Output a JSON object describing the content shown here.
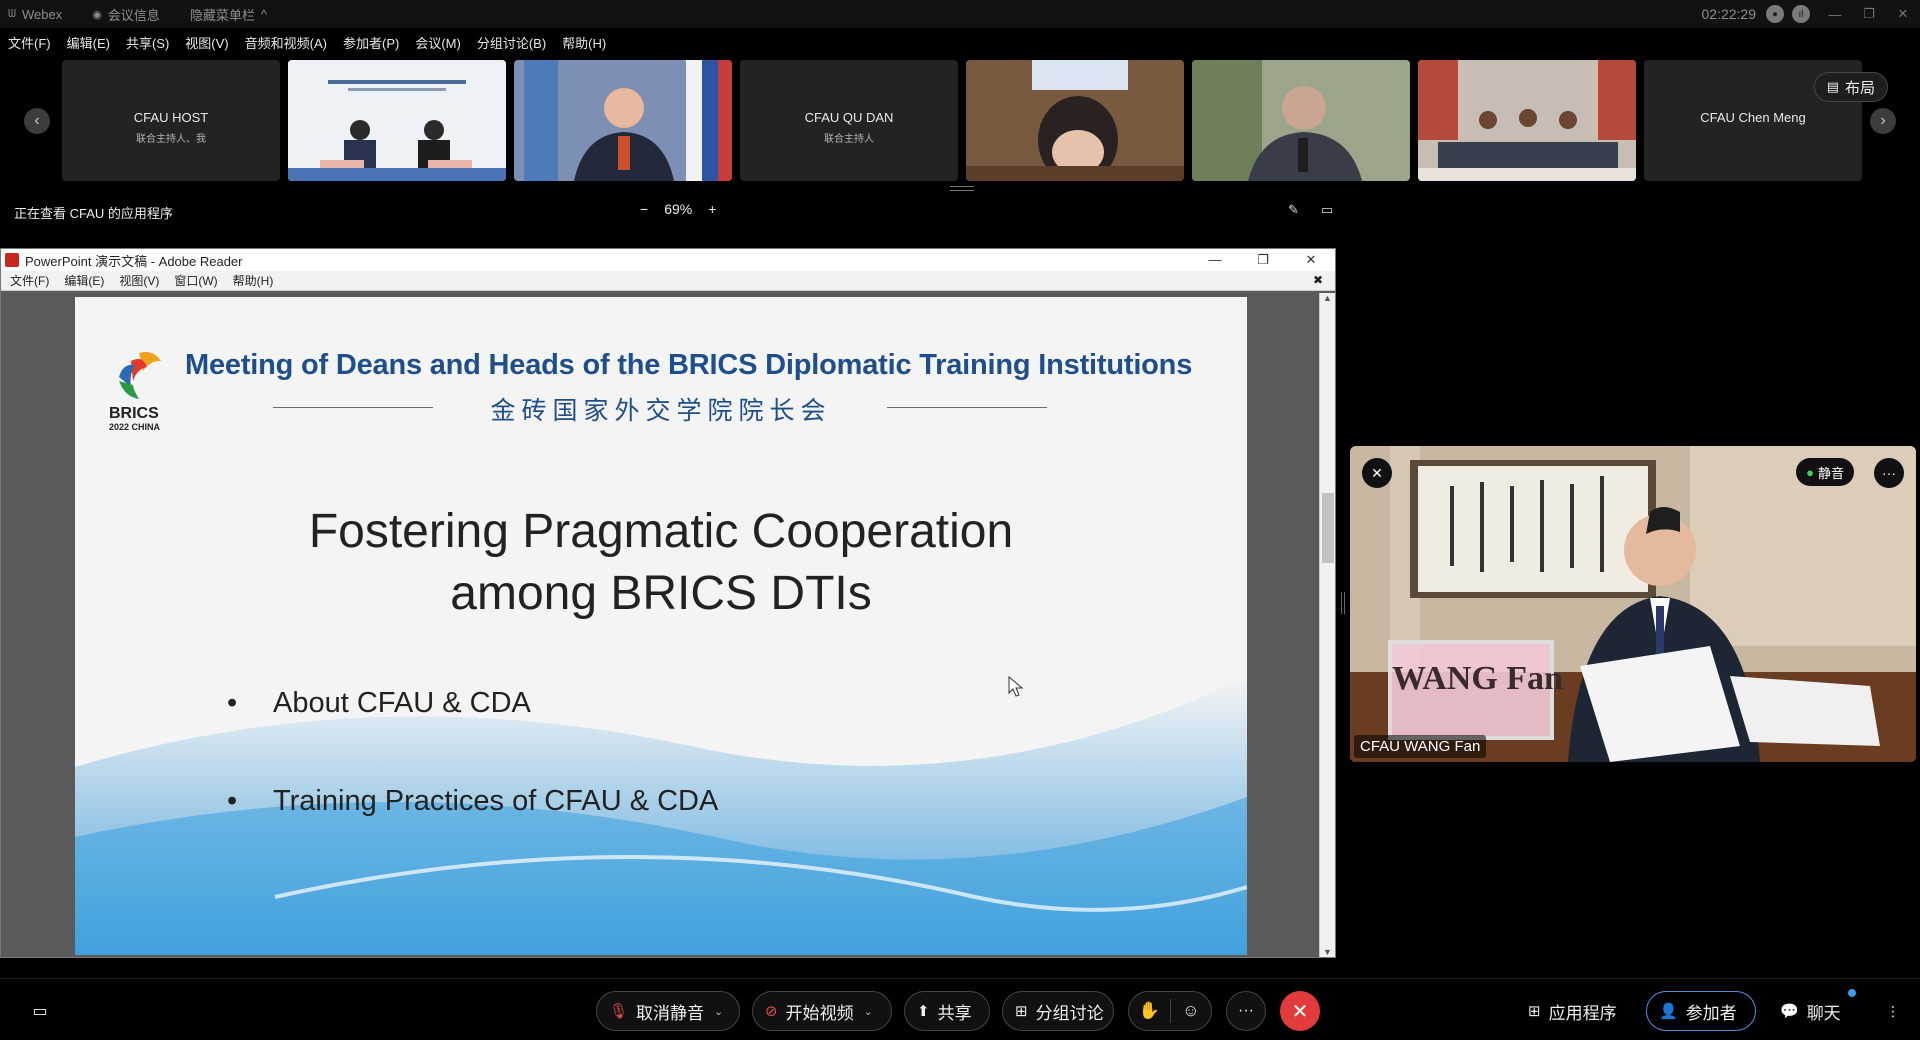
{
  "titlebar": {
    "app_name": "Webex",
    "meeting_info": "会议信息",
    "hide_menu": "隐藏菜单栏",
    "clock": "02:22:29"
  },
  "menubar": [
    "文件(F)",
    "编辑(E)",
    "共享(S)",
    "视图(V)",
    "音频和视频(A)",
    "参加者(P)",
    "会议(M)",
    "分组讨论(B)",
    "帮助(H)"
  ],
  "filmstrip": {
    "layout_label": "布局",
    "tiles": [
      {
        "name": "CFAU HOST",
        "role": "联合主持人、我"
      },
      {
        "name": "",
        "role": ""
      },
      {
        "name": "",
        "role": ""
      },
      {
        "name": "CFAU QU DAN",
        "role": "联合主持人"
      },
      {
        "name": "",
        "role": ""
      },
      {
        "name": "",
        "role": ""
      },
      {
        "name": "",
        "role": ""
      },
      {
        "name": "CFAU Chen Meng",
        "role": ""
      }
    ]
  },
  "viewbar": {
    "label": "正在查看 CFAU 的应用程序",
    "zoom": "69%"
  },
  "appwindow": {
    "title": "PowerPoint 演示文稿 - Adobe Reader",
    "menu": [
      "文件(F)",
      "编辑(E)",
      "视图(V)",
      "窗口(W)",
      "帮助(H)"
    ]
  },
  "slide": {
    "header_en": "Meeting of Deans and Heads of the BRICS Diplomatic Training Institutions",
    "header_cn": "金砖国家外交学院院长会",
    "logo_text": "BRICS",
    "logo_sub": "2022 CHINA",
    "title_line1": "Fostering Pragmatic Cooperation",
    "title_line2": "among BRICS DTIs",
    "bullets": [
      "About CFAU & CDA",
      "Training Practices of CFAU & CDA"
    ]
  },
  "video": {
    "name": "CFAU WANG Fan",
    "mute_label": "静音",
    "nameplate": "WANG Fan"
  },
  "bottombar": {
    "unmute": "取消静音",
    "start_video": "开始视频",
    "share": "共享",
    "breakout": "分组讨论",
    "apps": "应用程序",
    "participants": "参加者",
    "chat": "聊天"
  }
}
